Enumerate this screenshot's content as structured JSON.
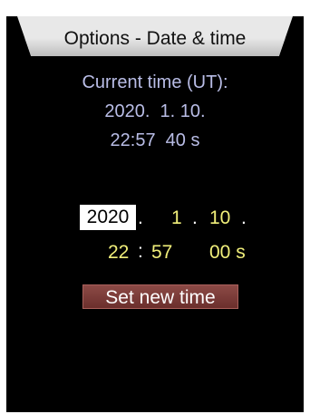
{
  "title": "Options - Date & time",
  "current_time": {
    "label": "Current time (UT):",
    "date": "2020.  1. 10.",
    "time": "22:57  40 s"
  },
  "edit": {
    "year": "2020",
    "year_sep": ".",
    "month": "1",
    "month_sep": ".",
    "day": "10",
    "day_sep": ".",
    "hour": "22",
    "hm_sep": ":",
    "minute": "57",
    "seconds": "00 s"
  },
  "set_button_label": "Set new time",
  "colors": {
    "background": "#000000",
    "title_bar": "#e8e8e8",
    "current_text": "#b9bde6",
    "edit_text": "#f1ef7a",
    "button": "#7a3b38"
  }
}
